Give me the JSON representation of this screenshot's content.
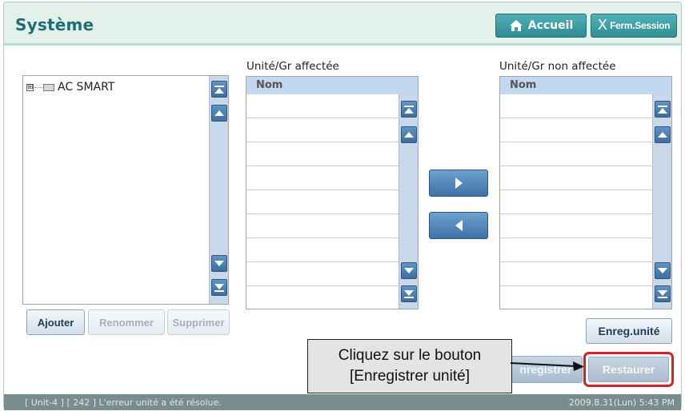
{
  "header": {
    "title": "Système",
    "home_label": "Accueil",
    "logout_label": "Ferm.Session"
  },
  "tree": {
    "expander": "⊞",
    "root_label": "AC SMART",
    "buttons": {
      "add": "Ajouter",
      "rename": "Renommer",
      "delete": "Supprimer"
    }
  },
  "assigned": {
    "label": "Unité/Gr affectée",
    "column": "Nom"
  },
  "unassigned": {
    "label": "Unité/Gr non affectée",
    "column": "Nom"
  },
  "actions": {
    "save_unit": "Enreg.unité",
    "save": "nregistrer",
    "restore": "Restaurer"
  },
  "callout": {
    "line1": "Cliquez sur le bouton",
    "line2": "[Enregistrer unité]"
  },
  "status": {
    "message": "[ Unit-4 ] [ 242 ] L'erreur unité a été résolue.",
    "datetime": "2009.8.31(Lun)  5:43 PM"
  },
  "colors": {
    "accent": "#2c8b90",
    "highlight": "#e31b23",
    "title": "#1f6d76"
  }
}
